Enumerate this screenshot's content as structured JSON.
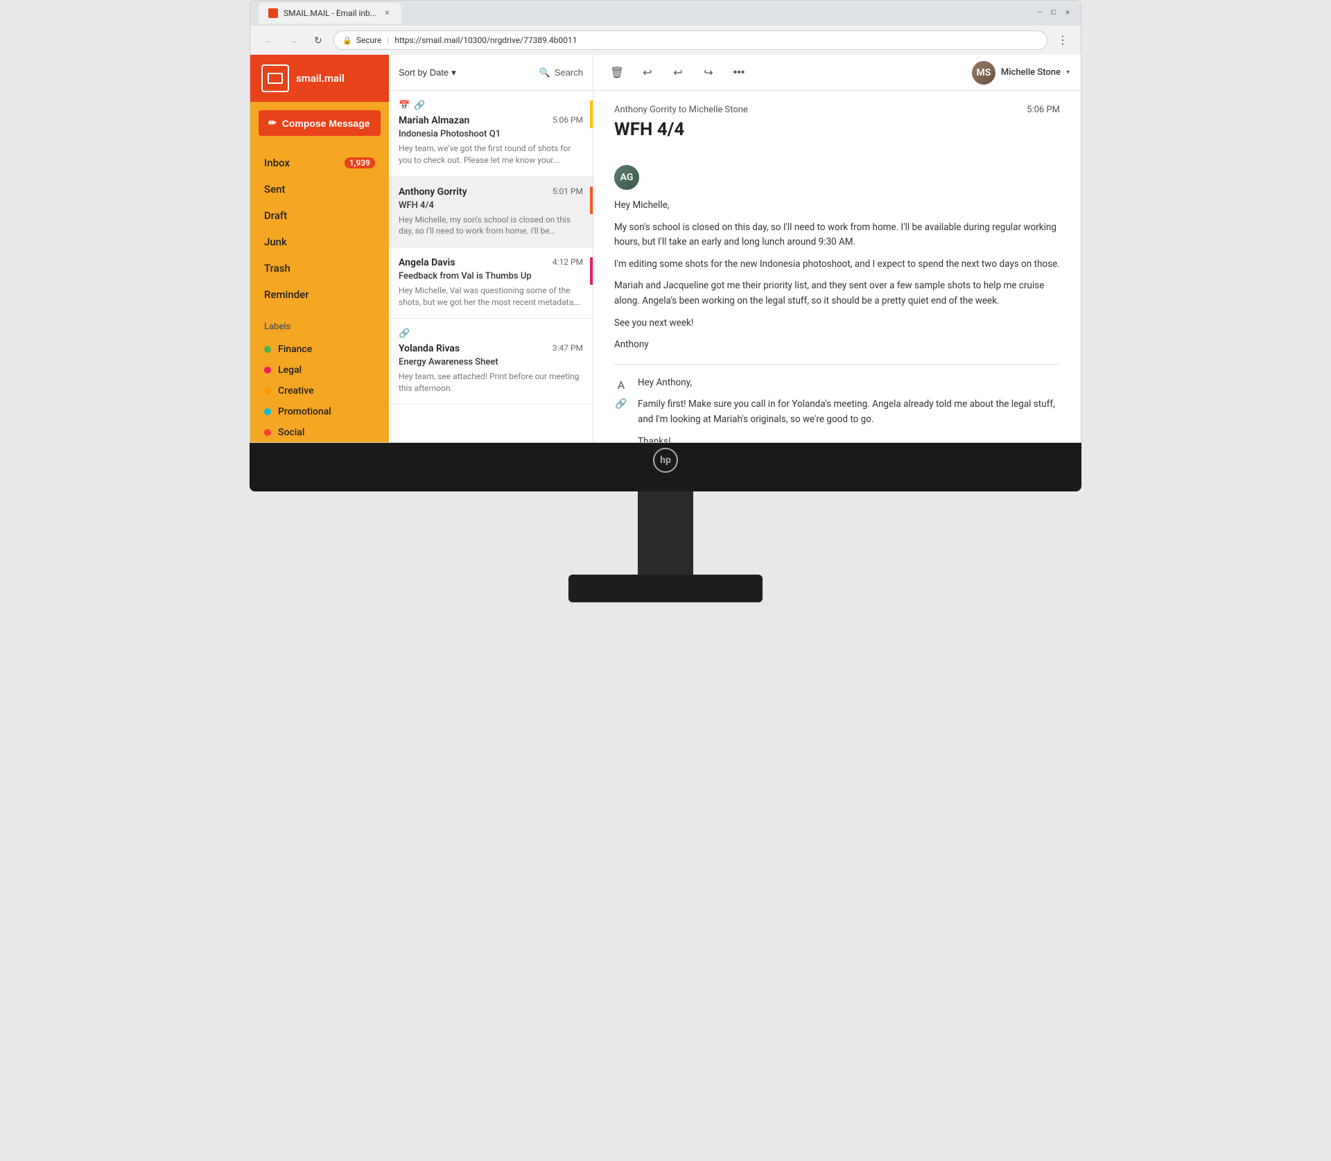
{
  "browser": {
    "tab_title": "SMAIL.MAIL - Email inb...",
    "url_protocol": "Secure",
    "url": "https://smail.mail/10300/nrgdrive/77389.4b0011"
  },
  "app": {
    "logo_text": "smail.mail",
    "compose_btn": "Compose Message"
  },
  "sidebar": {
    "nav_items": [
      {
        "label": "Inbox",
        "badge": "1,939"
      },
      {
        "label": "Sent",
        "badge": null
      },
      {
        "label": "Draft",
        "badge": null
      },
      {
        "label": "Junk",
        "badge": null
      },
      {
        "label": "Trash",
        "badge": null
      },
      {
        "label": "Reminder",
        "badge": null
      }
    ],
    "labels_title": "Labels",
    "labels": [
      {
        "name": "Finance",
        "color": "#4CAF50"
      },
      {
        "name": "Legal",
        "color": "#E91E63"
      },
      {
        "name": "Creative",
        "color": "#FF9800"
      },
      {
        "name": "Promotional",
        "color": "#00BCD4"
      },
      {
        "name": "Social",
        "color": "#F44336"
      }
    ]
  },
  "email_list": {
    "sort_label": "Sort by Date",
    "search_label": "Search",
    "emails": [
      {
        "sender": "Mariah Almazan",
        "subject": "Indonesia Photoshoot Q1",
        "time": "5:06 PM",
        "preview": "Hey team, we've got the first round of shots for you to check out. Please let me know your...",
        "indicator_color": "#FFC107",
        "has_calendar": true,
        "has_link": true
      },
      {
        "sender": "Anthony Gorrity",
        "subject": "WFH 4/4",
        "time": "5:01 PM",
        "preview": "Hey Michelle, my son's school is closed on this day, so I'll need to work from home. I'll be available...",
        "indicator_color": "#FF5722",
        "has_calendar": false,
        "has_link": false,
        "selected": true
      },
      {
        "sender": "Angela Davis",
        "subject": "Feedback from Val is Thumbs Up",
        "time": "4:12 PM",
        "preview": "Hey Michelle, Val was questioning some of the shots, but we got her the most recent metadata, and she said...",
        "indicator_color": "#E91E63",
        "has_calendar": false,
        "has_link": false
      },
      {
        "sender": "Yolanda Rivas",
        "subject": "Energy Awareness Sheet",
        "time": "3:47 PM",
        "preview": "Hey team, see attached! Print before our meeting this afternoon.",
        "indicator_color": null,
        "has_calendar": false,
        "has_link": true
      }
    ]
  },
  "email_view": {
    "from_to": "Anthony Gorrity to Michelle Stone",
    "time": "5:06 PM",
    "subject": "WFH 4/4",
    "messages": [
      {
        "greeting": "Hey Michelle,",
        "body": "My son's school is closed on this day, so I'll need to work from home. I'll be available during regular working hours, but I'll take an early and long lunch around 9:30 AM.\n\nI'm editing some shots for the new Indonesia photoshoot, and I expect to spend the next two days on those.\n\nMariah and Jacqueline got me their priority list, and they sent over a few sample shots to help me cruise along. Angela's been working on the legal stuff, so it should be a pretty quiet end of the week.\n\nSee you next week!\n\nAnthony",
        "avatar_initials": "AG"
      },
      {
        "greeting": "Hey Anthony,",
        "body": "Family first! Make sure you call in for Yolanda's meeting. Angela already told me about the legal stuff, and I'm looking at Mariah's originals, so we're good to go.\n\nThanks!",
        "avatar_initials": null,
        "is_reply": true
      }
    ],
    "user": {
      "name": "Michelle Stone",
      "initials": "MS"
    }
  }
}
